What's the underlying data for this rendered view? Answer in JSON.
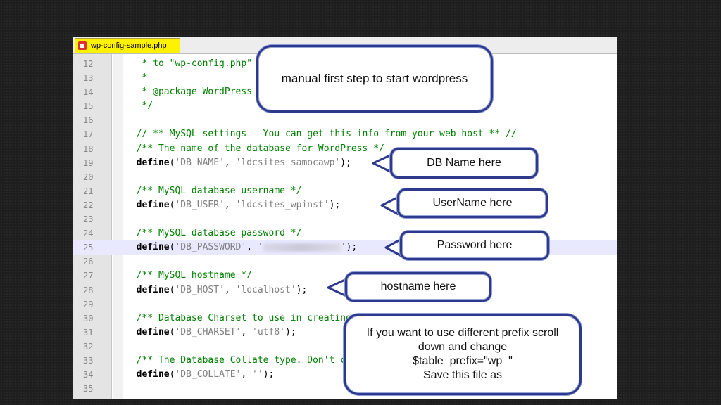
{
  "editor": {
    "tab_label": "wp-config-sample.php",
    "lines": [
      {
        "no": "12",
        "segments": [
          {
            "t": "   * to \"wp-config.php\"",
            "c": "c-comment"
          }
        ]
      },
      {
        "no": "13",
        "segments": [
          {
            "t": "   *",
            "c": "c-comment"
          }
        ]
      },
      {
        "no": "14",
        "segments": [
          {
            "t": "   * @package WordPress",
            "c": "c-comment"
          }
        ]
      },
      {
        "no": "15",
        "segments": [
          {
            "t": "   */",
            "c": "c-comment"
          }
        ]
      },
      {
        "no": "16",
        "segments": []
      },
      {
        "no": "17",
        "segments": [
          {
            "t": "  // ** MySQL settings - You can get this info from your web host ** //",
            "c": "c-comment"
          }
        ]
      },
      {
        "no": "18",
        "segments": [
          {
            "t": "  /** The name of the database for WordPress */",
            "c": "c-comment"
          }
        ]
      },
      {
        "no": "19",
        "segments": [
          {
            "t": "  define",
            "c": "c-kw"
          },
          {
            "t": "(",
            "c": "c-punc"
          },
          {
            "t": "'DB_NAME'",
            "c": "c-str"
          },
          {
            "t": ", ",
            "c": "c-punc"
          },
          {
            "t": "'ldcsites_samocawp'",
            "c": "c-str"
          },
          {
            "t": ");",
            "c": "c-punc"
          }
        ]
      },
      {
        "no": "20",
        "segments": []
      },
      {
        "no": "21",
        "segments": [
          {
            "t": "  /** MySQL database username */",
            "c": "c-comment"
          }
        ]
      },
      {
        "no": "22",
        "segments": [
          {
            "t": "  define",
            "c": "c-kw"
          },
          {
            "t": "(",
            "c": "c-punc"
          },
          {
            "t": "'DB_USER'",
            "c": "c-str"
          },
          {
            "t": ", ",
            "c": "c-punc"
          },
          {
            "t": "'ldcsites_wpinst'",
            "c": "c-str"
          },
          {
            "t": ");",
            "c": "c-punc"
          }
        ]
      },
      {
        "no": "23",
        "segments": []
      },
      {
        "no": "24",
        "segments": [
          {
            "t": "  /** MySQL database password */",
            "c": "c-comment"
          }
        ]
      },
      {
        "no": "25",
        "highlight": true,
        "segments": [
          {
            "t": "  define",
            "c": "c-kw"
          },
          {
            "t": "(",
            "c": "c-punc"
          },
          {
            "t": "'DB_PASSWORD'",
            "c": "c-str"
          },
          {
            "t": ", ",
            "c": "c-punc"
          },
          {
            "t": "'",
            "c": "c-str"
          },
          {
            "blur": true
          },
          {
            "t": "'",
            "c": "c-str"
          },
          {
            "t": ");",
            "c": "c-punc"
          }
        ]
      },
      {
        "no": "26",
        "segments": []
      },
      {
        "no": "27",
        "segments": [
          {
            "t": "  /** MySQL hostname */",
            "c": "c-comment"
          }
        ]
      },
      {
        "no": "28",
        "segments": [
          {
            "t": "  define",
            "c": "c-kw"
          },
          {
            "t": "(",
            "c": "c-punc"
          },
          {
            "t": "'DB_HOST'",
            "c": "c-str"
          },
          {
            "t": ", ",
            "c": "c-punc"
          },
          {
            "t": "'localhost'",
            "c": "c-str"
          },
          {
            "t": ");",
            "c": "c-punc"
          }
        ]
      },
      {
        "no": "29",
        "segments": []
      },
      {
        "no": "30",
        "segments": [
          {
            "t": "  /** Database Charset to use in creating database tables. */",
            "c": "c-comment"
          }
        ]
      },
      {
        "no": "31",
        "segments": [
          {
            "t": "  define",
            "c": "c-kw"
          },
          {
            "t": "(",
            "c": "c-punc"
          },
          {
            "t": "'DB_CHARSET'",
            "c": "c-str"
          },
          {
            "t": ", ",
            "c": "c-punc"
          },
          {
            "t": "'utf8'",
            "c": "c-str"
          },
          {
            "t": ");",
            "c": "c-punc"
          }
        ]
      },
      {
        "no": "32",
        "segments": []
      },
      {
        "no": "33",
        "segments": [
          {
            "t": "  /** The Database Collate type. Don't change this if in doubt. */",
            "c": "c-comment"
          }
        ]
      },
      {
        "no": "34",
        "segments": [
          {
            "t": "  define",
            "c": "c-kw"
          },
          {
            "t": "(",
            "c": "c-punc"
          },
          {
            "t": "'DB_COLLATE'",
            "c": "c-str"
          },
          {
            "t": ", ",
            "c": "c-punc"
          },
          {
            "t": "''",
            "c": "c-str"
          },
          {
            "t": ");",
            "c": "c-punc"
          }
        ]
      },
      {
        "no": "35",
        "segments": []
      }
    ]
  },
  "callouts": {
    "manual": "manual first step to start wordpress",
    "db_name": "DB Name here",
    "username": "UserName here",
    "password": "Password here",
    "hostname": "hostname here",
    "prefix_l1": "If you want to use different prefix scroll",
    "prefix_l2": "down and change",
    "prefix_l3": "$table_prefix=\"wp_\"",
    "prefix_l4": "Save this file as"
  },
  "colors": {
    "callout_border": "#2d3a8c",
    "tab_bg": "#fff200",
    "comment": "#008000"
  }
}
